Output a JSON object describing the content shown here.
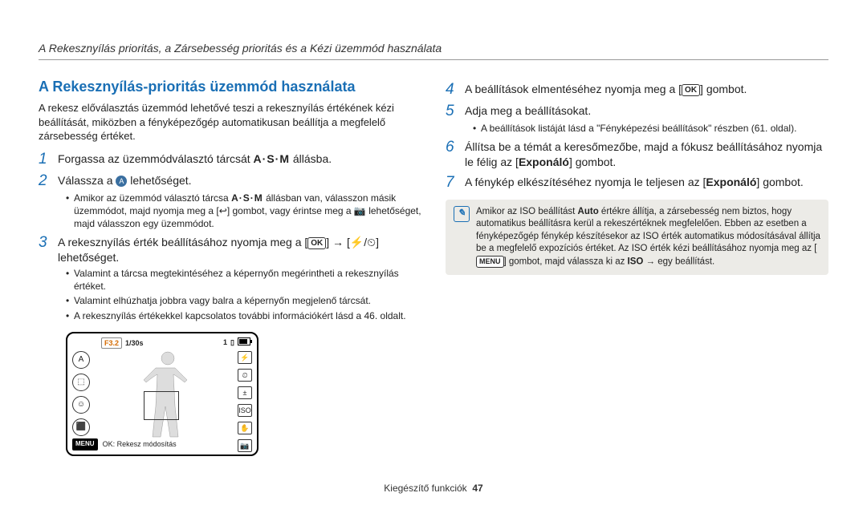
{
  "header": "A Rekesznyílás prioritás, a Zársebesség prioritás és a Kézi üzemmód használata",
  "section_title": "A Rekesznyílás-prioritás üzemmód használata",
  "intro": "A rekesz előválasztás üzemmód lehetővé teszi a rekesznyílás értékének kézi beállítását, miközben a fényképezőgép automatikusan beállítja a megfelelő zársebesség értéket.",
  "left_steps": [
    {
      "num": "1",
      "pre": "Forgassa az üzemmódválasztó tárcsát ",
      "mid": "A·S·M",
      "post": " állásba."
    },
    {
      "num": "2",
      "pre": "Válassza a ",
      "icon": "mode",
      "post": " lehetőséget."
    },
    {
      "num": "3",
      "text": "A rekesznyílás érték beállításához nyomja meg a [OK] → [⚡/⏲] lehetőséget."
    }
  ],
  "bullets_after_2": [
    "Amikor az üzemmód választó tárcsa A·S·M állásban van, válasszon másik üzemmódot, majd nyomja meg a [↩] gombot, vagy érintse meg a 📷 lehetőséget, majd válasszon egy üzemmódot."
  ],
  "bullets_after_3": [
    "Valamint a tárcsa megtekintéséhez a képernyőn megérintheti a rekesznyílás értéket.",
    "Valamint elhúzhatja jobbra vagy balra a képernyőn megjelenő tárcsát.",
    "A rekesznyílás értékekkel kapcsolatos további információkért lásd a 46. oldalt."
  ],
  "right_steps": [
    {
      "num": "4",
      "text": "A beállítások elmentéséhez nyomja meg a [OK] gombot."
    },
    {
      "num": "5",
      "text": "Adja meg a beállításokat."
    },
    {
      "num": "6",
      "text": "Állítsa be a témát a keresőmezőbe, majd a fókusz beállításához nyomja le félig az [Exponáló] gombot.",
      "bold": "Exponáló"
    },
    {
      "num": "7",
      "text": "A fénykép elkészítéséhez nyomja le teljesen az [Exponáló] gombot.",
      "bold": "Exponáló"
    }
  ],
  "bullets_after_5": [
    "A beállítások listáját lásd a \"Fényképezési beállítások\" részben (61. oldal)."
  ],
  "note": "Amikor az ISO beállítást Auto értékre állítja, a zársebesség nem biztos, hogy automatikus beállításra kerül a rekeszértéknek megfelelően. Ebben az esetben a fényképezőgép fénykép készítésekor az ISO érték automatikus módosításával állítja be a megfelelő expozíciós értéket. Az ISO érték kézi beállításához nyomja meg az [MENU] gombot, majd válassza ki az ISO → egy beállítást.",
  "note_bold_words": [
    "Auto",
    "MENU",
    "ISO"
  ],
  "lcd": {
    "f": "F3.2",
    "shutter": "1/30s",
    "count": "1",
    "menu": "MENU",
    "bottom_text": "OK: Rekesz módosítás"
  },
  "footer": {
    "label": "Kiegészítő funkciók",
    "page": "47"
  }
}
